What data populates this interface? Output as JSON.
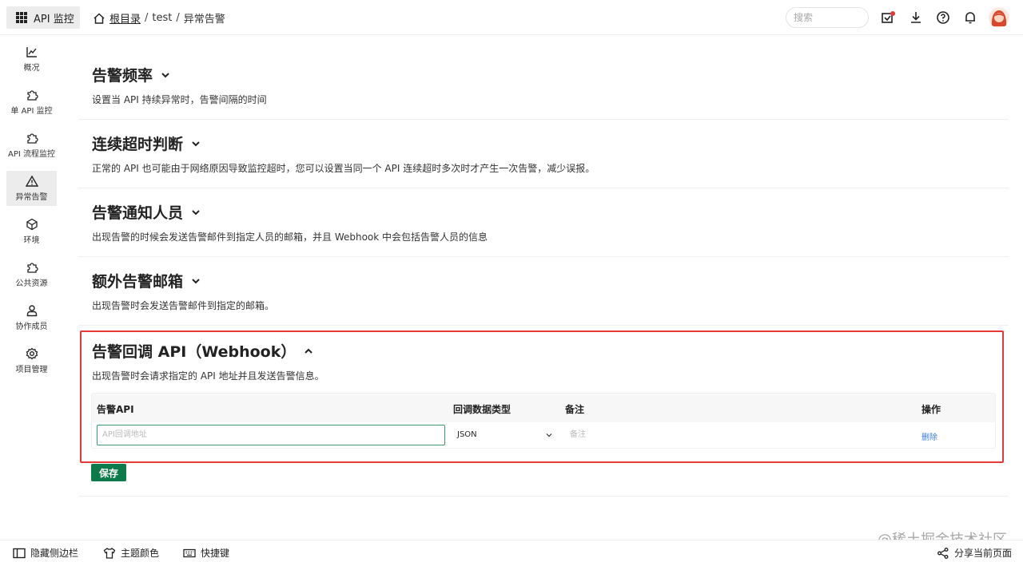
{
  "topbar": {
    "app_title": "API 监控",
    "breadcrumb": [
      "根目录",
      "test",
      "异常告警"
    ],
    "search_placeholder": "搜索"
  },
  "sidebar": {
    "items": [
      {
        "label": "概况",
        "icon": "line-chart-icon",
        "active": false
      },
      {
        "label": "单 API 监控",
        "icon": "puzzle-icon",
        "active": false
      },
      {
        "label": "API 流程监控",
        "icon": "puzzle-icon",
        "active": false
      },
      {
        "label": "异常告警",
        "icon": "warning-icon",
        "active": true
      },
      {
        "label": "环境",
        "icon": "cube-icon",
        "active": false
      },
      {
        "label": "公共资源",
        "icon": "puzzle-icon",
        "active": false
      },
      {
        "label": "协作成员",
        "icon": "user-icon",
        "active": false
      },
      {
        "label": "项目管理",
        "icon": "gear-icon",
        "active": false
      }
    ]
  },
  "sections": [
    {
      "title": "告警频率",
      "desc": "设置当 API 持续异常时，告警间隔的时间",
      "expanded": false
    },
    {
      "title": "连续超时判断",
      "desc": "正常的 API 也可能由于网络原因导致监控超时，您可以设置当同一个 API 连续超时多次时才产生一次告警，减少误报。",
      "expanded": false
    },
    {
      "title": "告警通知人员",
      "desc": "出现告警的时候会发送告警邮件到指定人员的邮箱，并且 Webhook 中会包括告警人员的信息",
      "expanded": false
    },
    {
      "title": "额外告警邮箱",
      "desc": "出现告警时会发送告警邮件到指定的邮箱。",
      "expanded": false
    },
    {
      "title": "告警回调 API（Webhook）",
      "desc": "出现告警时会请求指定的 API 地址并且发送告警信息。",
      "expanded": true
    }
  ],
  "webhook_table": {
    "headers": [
      "告警API",
      "回调数据类型",
      "备注",
      "操作"
    ],
    "row": {
      "api_placeholder": "API回调地址",
      "data_type": "JSON",
      "remark_placeholder": "备注",
      "action": "删除"
    }
  },
  "save_label": "保存",
  "bottombar": {
    "hide_sidebar": "隐藏侧边栏",
    "theme_color": "主题颜色",
    "shortcuts": "快捷键",
    "share": "分享当前页面"
  },
  "watermark": "@稀土掘金技术社区",
  "colors": {
    "accent": "#0d7a4a",
    "highlight_border": "#e53935",
    "link": "#3a7fe0"
  }
}
